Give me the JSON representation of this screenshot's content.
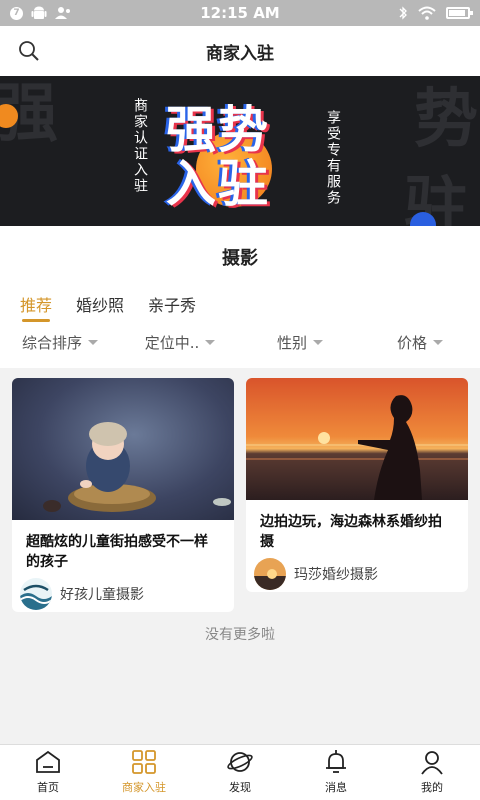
{
  "status": {
    "time": "12:15 AM",
    "badge": "7"
  },
  "header": {
    "title": "商家入驻",
    "search_icon": "search-icon"
  },
  "banner": {
    "left_vertical": "商家认证入驻",
    "headline_line1": "强势",
    "headline_line2": "入驻",
    "right_vertical": "享受专有服务",
    "bg_char_tl": "强",
    "bg_char_tr": "势",
    "bg_char_br": "驻"
  },
  "section": {
    "title": "摄影",
    "tabs": [
      {
        "label": "推荐",
        "active": true
      },
      {
        "label": "婚纱照",
        "active": false
      },
      {
        "label": "亲子秀",
        "active": false
      }
    ],
    "filters": [
      {
        "label": "综合排序"
      },
      {
        "label": "定位中.."
      },
      {
        "label": "性别"
      },
      {
        "label": "价格"
      }
    ]
  },
  "cards": [
    {
      "title": "超酷炫的儿童街拍感受不一样的孩子",
      "author": "好孩儿童摄影"
    },
    {
      "title": "边拍边玩，海边森林系婚纱拍摄",
      "author": "玛莎婚纱摄影"
    }
  ],
  "no_more": "没有更多啦",
  "nav": {
    "items": [
      {
        "label": "首页",
        "icon": "home-icon"
      },
      {
        "label": "商家入驻",
        "icon": "grid-icon"
      },
      {
        "label": "发现",
        "icon": "planet-icon"
      },
      {
        "label": "消息",
        "icon": "bell-icon"
      },
      {
        "label": "我的",
        "icon": "user-icon"
      }
    ]
  },
  "colors": {
    "accent": "#d4962a",
    "banner_bg": "#1c1d20",
    "status_bar": "#b8b8b8"
  }
}
